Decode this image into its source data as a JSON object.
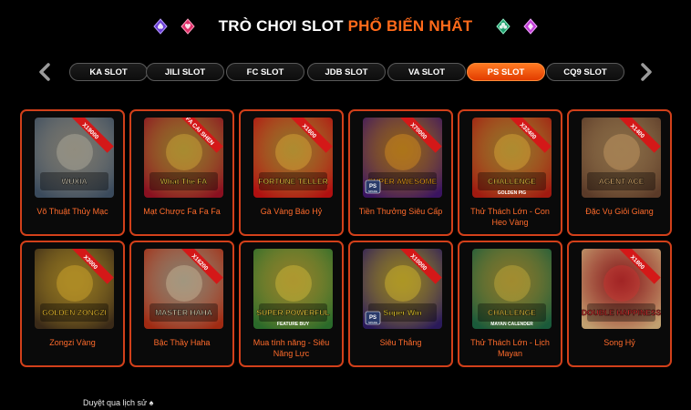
{
  "header": {
    "title_main": "TRÒ CHƠI SLOT ",
    "title_accent": "PHỔ BIẾN NHẤT",
    "left_icons": [
      "spade-gem-icon",
      "heart-gem-icon"
    ],
    "right_icons": [
      "club-gem-icon",
      "diamond-gem-icon"
    ]
  },
  "tabs": [
    {
      "label": "KA SLOT",
      "active": false
    },
    {
      "label": "JILI SLOT",
      "active": false
    },
    {
      "label": "FC SLOT",
      "active": false
    },
    {
      "label": "JDB SLOT",
      "active": false
    },
    {
      "label": "VA SLOT",
      "active": false
    },
    {
      "label": "PS SLOT",
      "active": true
    },
    {
      "label": "CQ9 SLOT",
      "active": false
    }
  ],
  "games": [
    {
      "name": "Võ Thuật Thủy Mạc",
      "badge": "X19000",
      "art_text": "WUXIA"
    },
    {
      "name": "Mạt Chược Fa Fa Fa",
      "badge": "FA CAI SHEN",
      "art_text": "What The FA"
    },
    {
      "name": "Gà Vàng Báo Hỷ",
      "badge": "X1600",
      "art_text": "FORTUNE TELLER"
    },
    {
      "name": "Tiền Thưởng Siêu Cấp",
      "badge": "X70000",
      "art_text": "SUPER AWESOME",
      "logo": "PS SPADE"
    },
    {
      "name": "Thử Thách Lớn - Con Heo Vàng",
      "badge": "X32400",
      "art_text": "CHALLENGE",
      "sub_text": "GOLDEN PIG"
    },
    {
      "name": "Đặc Vụ Giỏi Giang",
      "badge": "X1400",
      "art_text": "AGENT ACE"
    },
    {
      "name": "Zongzi Vàng",
      "badge": "X3000",
      "art_text": "GOLDEN ZONGZI"
    },
    {
      "name": "Bậc Thầy Haha",
      "badge": "X16200",
      "art_text": "MASTER HAHA"
    },
    {
      "name": "Mua tính năng - Siêu Năng Lực",
      "badge": "",
      "art_text": "SUPER POWERFUL",
      "sub_text": "FEATURE BUY"
    },
    {
      "name": "Siêu Thắng",
      "badge": "X10000",
      "art_text": "Super Win",
      "logo": "PS SPADE"
    },
    {
      "name": "Thử Thách Lớn - Lịch Mayan",
      "badge": "",
      "art_text": "CHALLENGE",
      "sub_text": "MAYAN CALENDER"
    },
    {
      "name": "Song Hỷ",
      "badge": "X1800",
      "art_text": "DOUBLE HAPPINESS"
    }
  ],
  "footer": {
    "text": "Duyệt qua lịch sử"
  },
  "colors": {
    "accent": "#ff6a1a",
    "card_border": "#d2401a",
    "active_tab": "#f05a12"
  }
}
